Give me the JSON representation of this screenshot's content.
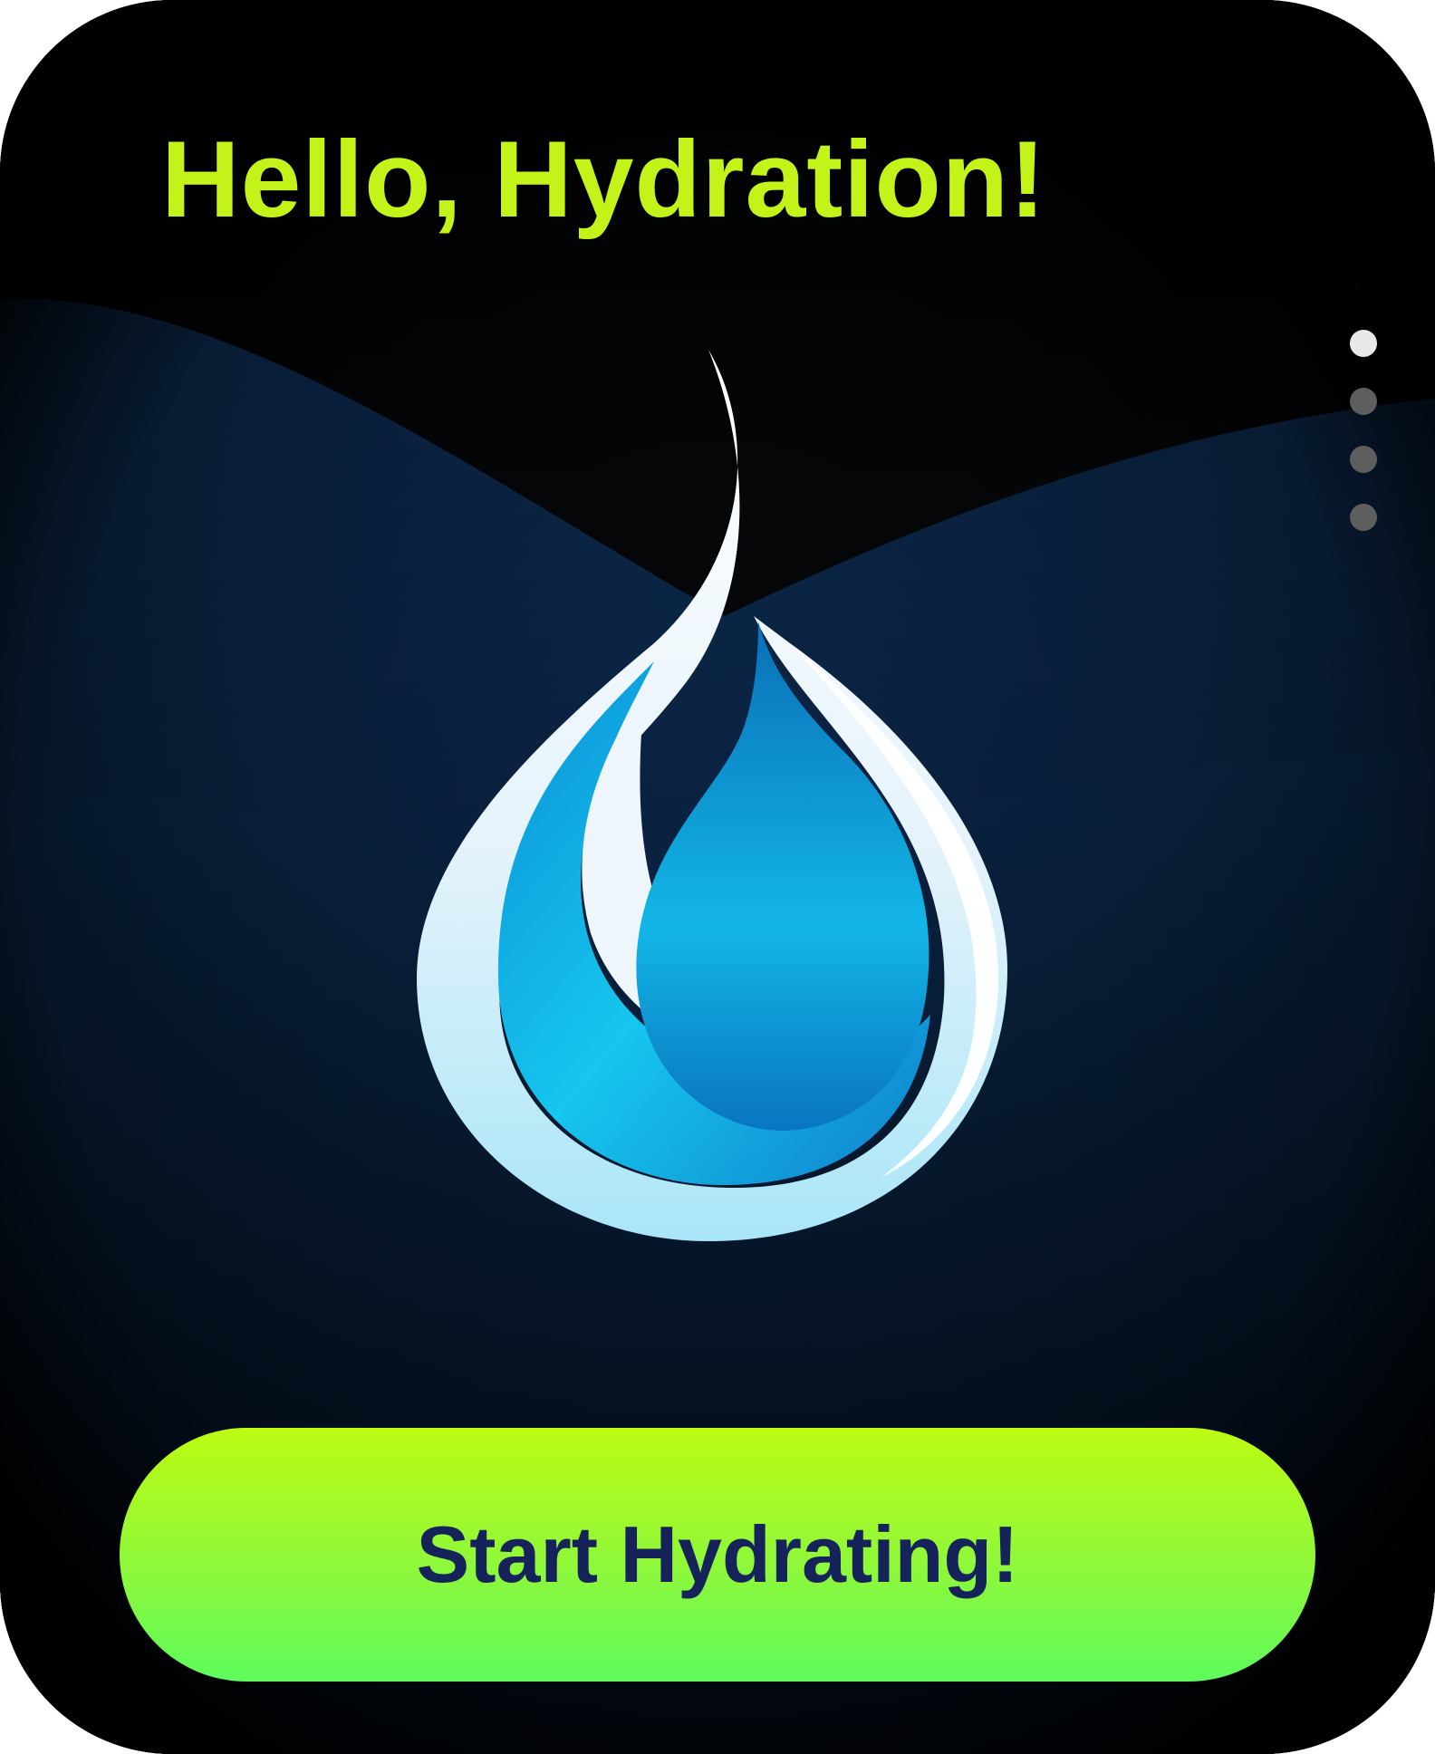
{
  "header": {
    "title": "Hello, Hydration!"
  },
  "pager": {
    "total": 4,
    "current": 1
  },
  "logo": {
    "icon": "water-drop-icon"
  },
  "action": {
    "start_label": "Start Hydrating!"
  },
  "colors": {
    "accent": "#c4f31a",
    "button_top": "#bdfb12",
    "button_bottom": "#5efa5c",
    "button_text": "#15235a",
    "background": "#000000",
    "wave": "#0b2a4f"
  }
}
